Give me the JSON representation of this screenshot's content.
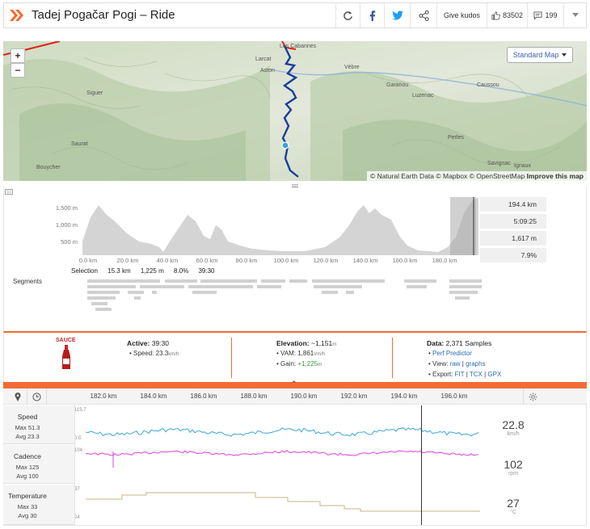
{
  "header": {
    "title": "Tadej Pogačar Pogi – Ride",
    "give_kudos": "Give kudos",
    "kudos_count": "83502",
    "comments_count": "199"
  },
  "map": {
    "zoom_in": "+",
    "zoom_out": "−",
    "map_type": "Standard Map",
    "attribution_prefix": "© Natural Earth Data © Mapbox © OpenStreetMap",
    "attribution_link": "Improve this map",
    "towns": [
      "Les Cabannes",
      "Larcat",
      "Aston",
      "Vèbre",
      "Siguer",
      "Garanou",
      "Luzenac",
      "Caussou",
      "Saurat",
      "Perles",
      "Bouycher",
      "Savignac",
      "Ignaux"
    ]
  },
  "elevation": {
    "y_ticks": [
      "1,500 m",
      "1,000 m",
      "500 m"
    ],
    "x_ticks": [
      "0.0 km",
      "20.0 km",
      "40.0 km",
      "60.0 km",
      "80.0 km",
      "100.0 km",
      "120.0 km",
      "140.0 km",
      "160.0 km",
      "180.0 km"
    ],
    "stats": [
      "194.4 km",
      "5:09:25",
      "1,617 m",
      "7.9%"
    ],
    "selection_label": "Selection",
    "selection_values": [
      "15.3 km",
      "1,225 m",
      "8.0%",
      "39:30"
    ],
    "segments_label": "Segments"
  },
  "sauce": {
    "logo_text": "SAUCE",
    "active_label": "Active:",
    "active_value": "39:30",
    "speed_label": "• Speed:",
    "speed_value": "23.3",
    "speed_unit": "km/h",
    "elevation_label": "Elevation:",
    "elevation_value": "~1,151",
    "elevation_unit": "m",
    "vam_label": "• VAM:",
    "vam_value": "1,861",
    "vam_unit": "Vm/h",
    "gain_label": "• Gain:",
    "gain_value": "+1,225",
    "gain_unit": "m",
    "data_label": "Data:",
    "data_value": "2,371 Samples",
    "perf_predictor": "Perf Predictor",
    "view_label": "• View:",
    "view_raw": "raw",
    "view_graphs": "graphs",
    "export_label": "• Export:",
    "export_fit": "FIT",
    "export_tcx": "TCX",
    "export_gpx": "GPX",
    "collapse_glyph": "⌃"
  },
  "lower_chart": {
    "x_ticks": [
      "182.0 km",
      "184.0 km",
      "186.0 km",
      "188.0 km",
      "190.0 km",
      "192.0 km",
      "194.0 km",
      "196.0 km"
    ],
    "rows": [
      {
        "name": "Speed",
        "max": "Max 51.3",
        "avg": "Avg 23.3",
        "top": "115.7",
        "bottom": "0.0",
        "value": "22.8",
        "unit": "km/h",
        "color": "#3aa6d8"
      },
      {
        "name": "Cadence",
        "max": "Max 125",
        "avg": "Avg 100",
        "top": "104",
        "bottom": "",
        "value": "102",
        "unit": "rpm",
        "color": "#e040e0"
      },
      {
        "name": "Temperature",
        "max": "Max 33",
        "avg": "Avg 30",
        "top": "37",
        "bottom": "24",
        "value": "27",
        "unit": "°C",
        "color": "#c8b680"
      }
    ]
  },
  "colors": {
    "accent": "#f26b35",
    "route": "#1a3e9c",
    "link": "#2a6bb5"
  }
}
